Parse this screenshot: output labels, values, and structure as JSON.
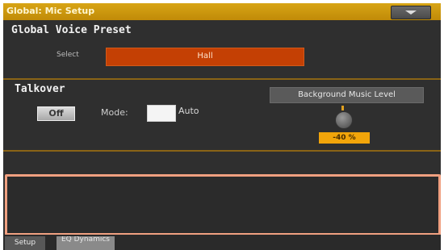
{
  "window": {
    "title": "Global: Mic Setup"
  },
  "menu_icon": "chevron-down-icon",
  "preset": {
    "heading": "Global Voice Preset",
    "select_label": "Select",
    "select_value": "Hall"
  },
  "talkover": {
    "heading": "Talkover",
    "toggle_label": "Off",
    "mode_label": "Mode:",
    "mode_value": "Auto",
    "background_level_label": "Background Music Level",
    "background_level_value": "-40 %"
  },
  "tabs": [
    {
      "label": "Setup"
    },
    {
      "label": "EQ Dynamics"
    }
  ],
  "colors": {
    "accent": "#c89010",
    "select_fill": "#c44004",
    "value_fill": "#f2a50a",
    "panel_border": "#f0a080"
  }
}
